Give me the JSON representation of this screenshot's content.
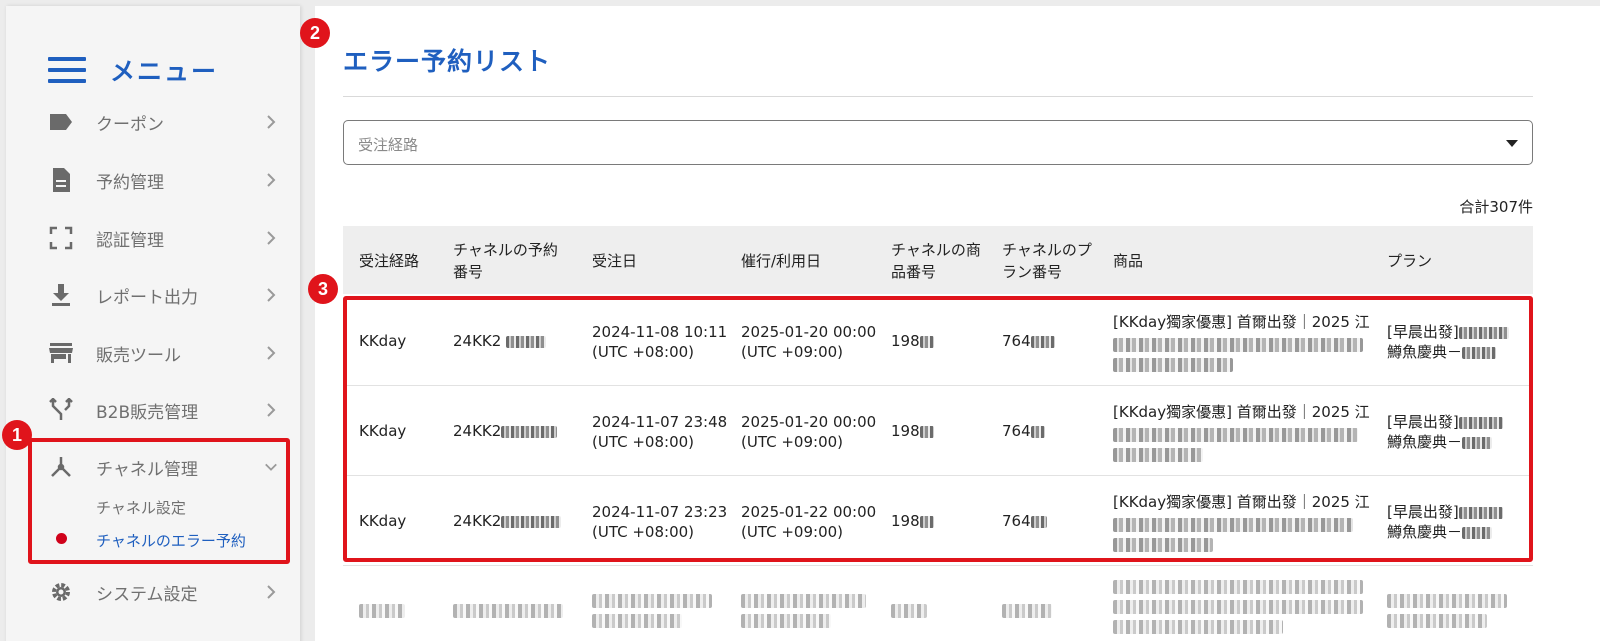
{
  "sidebar": {
    "title": "メニュー",
    "items": [
      {
        "label": "クーポン",
        "icon": "label-tag-icon"
      },
      {
        "label": "予約管理",
        "icon": "document-icon"
      },
      {
        "label": "認証管理",
        "icon": "scan-frame-icon"
      },
      {
        "label": "レポート出力",
        "icon": "download-icon"
      },
      {
        "label": "販売ツール",
        "icon": "store-icon"
      },
      {
        "label": "B2B販売管理",
        "icon": "merge-arrows-icon"
      },
      {
        "label": "チャネル管理",
        "icon": "channel-hub-icon"
      },
      {
        "label": "システム設定",
        "icon": "gear-icon"
      }
    ],
    "sub_items": [
      {
        "label": "チャネル設定"
      },
      {
        "label": "チャネルのエラー予約"
      }
    ]
  },
  "badges": [
    "1",
    "2",
    "3"
  ],
  "main": {
    "title": "エラー予約リスト",
    "filter": {
      "placeholder": "受注経路"
    },
    "total": "合計307件"
  },
  "table": {
    "headers": [
      [
        "受注経路"
      ],
      [
        "チャネルの予約",
        "番号"
      ],
      [
        "受注日"
      ],
      [
        "催行/利用日"
      ],
      [
        "チャネルの商",
        "品番号"
      ],
      [
        "チャネルのプ",
        "ラン番号"
      ],
      [
        "商品"
      ],
      [
        "プラン"
      ]
    ],
    "rows": [
      {
        "channel": "KKday",
        "booking_no": "24KK2",
        "order_date": "2024-11-08 10:11",
        "order_tz": "(UTC +08:00)",
        "use_date": "2025-01-20 00:00",
        "use_tz": "(UTC +09:00)",
        "product_no": "198",
        "plan_no": "764",
        "product": "[KKday獨家優惠] 首爾出發｜2025 江",
        "plan_l1": "[早晨出發]",
        "plan_l2": "鱒魚慶典－"
      },
      {
        "channel": "KKday",
        "booking_no": "24KK2",
        "order_date": "2024-11-07 23:48",
        "order_tz": "(UTC +08:00)",
        "use_date": "2025-01-20 00:00",
        "use_tz": "(UTC +09:00)",
        "product_no": "198",
        "plan_no": "764",
        "product": "[KKday獨家優惠] 首爾出發｜2025 江",
        "plan_l1": "[早晨出發]",
        "plan_l2": "鱒魚慶典－"
      },
      {
        "channel": "KKday",
        "booking_no": "24KK2",
        "order_date": "2024-11-07 23:23",
        "order_tz": "(UTC +08:00)",
        "use_date": "2025-01-22 00:00",
        "use_tz": "(UTC +09:00)",
        "product_no": "198",
        "plan_no": "764",
        "product": "[KKday獨家優惠] 首爾出發｜2025 江",
        "plan_l1": "[早晨出發]",
        "plan_l2": "鱒魚慶典－"
      }
    ]
  },
  "colors": {
    "accent": "#1f5fbf",
    "highlight": "#e0141b",
    "active_dot": "#d0021b"
  }
}
